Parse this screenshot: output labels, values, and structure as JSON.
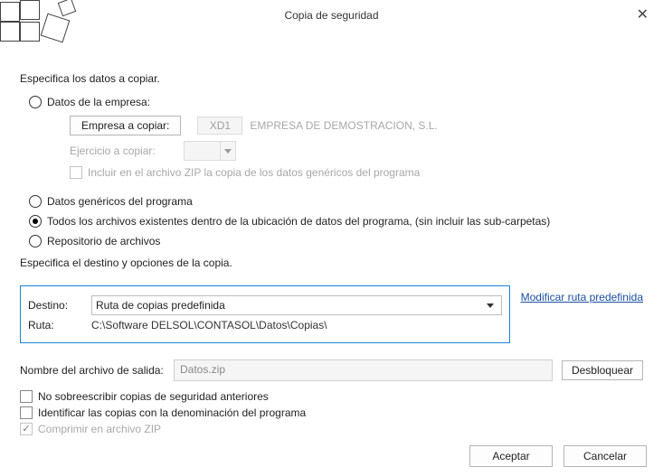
{
  "title": "Copia de seguridad",
  "section1": {
    "heading": "Especifica los datos a copiar.",
    "opt_empresa": "Datos de la empresa:",
    "empresa_btn": "Empresa a copiar:",
    "empresa_code": "XD1",
    "empresa_name": "EMPRESA DE DEMOSTRACION, S.L.",
    "ejercicio_label": "Ejercicio a copiar:",
    "include_zip": "Incluir en el archivo ZIP la copia de los datos genéricos del programa",
    "opt_genericos": "Datos genéricos del programa",
    "opt_todos": "Todos los archivos existentes dentro de la ubicación de datos del programa, (sin incluir las sub-carpetas)",
    "opt_repo": "Repositorio de archivos"
  },
  "section2": {
    "heading": "Especifica el destino y opciones de la copia.",
    "destino_label": "Destino:",
    "destino_value": "Ruta de copias predefinida",
    "modificar_link": "Modificar ruta predefinida",
    "ruta_label": "Ruta:",
    "ruta_value": "C:\\Software DELSOL\\CONTASOL\\Datos\\Copias\\",
    "outname_label": "Nombre del archivo de salida:",
    "outname_value": "Datos.zip",
    "unlock_btn": "Desbloquear",
    "chk_no_overwrite": "No sobreescribir copias de seguridad anteriores",
    "chk_ident": "Identificar las copias con la denominación del programa",
    "chk_zip": "Comprimir en archivo ZIP"
  },
  "footer": {
    "ok": "Aceptar",
    "cancel": "Cancelar"
  }
}
